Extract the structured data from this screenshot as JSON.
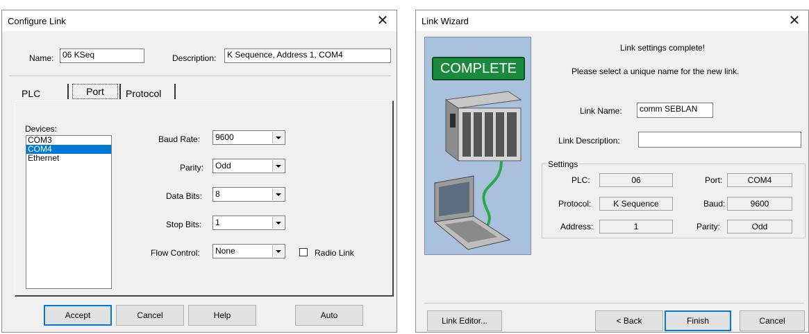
{
  "configure_link": {
    "title": "Configure Link",
    "close_symbol": "✕",
    "name_label": "Name:",
    "name_value": "06 KSeq",
    "description_label": "Description:",
    "description_value": "K Sequence, Address 1, COM4",
    "tabs": [
      {
        "label": "PLC"
      },
      {
        "label": "Port"
      },
      {
        "label": "Protocol"
      }
    ],
    "devices_label": "Devices:",
    "devices": [
      "COM3",
      "COM4",
      "Ethernet"
    ],
    "selected_device": "COM4",
    "baud_rate_label": "Baud Rate:",
    "baud_rate_value": "9600",
    "parity_label": "Parity:",
    "parity_value": "Odd",
    "data_bits_label": "Data Bits:",
    "data_bits_value": "8",
    "stop_bits_label": "Stop Bits:",
    "stop_bits_value": "1",
    "flow_control_label": "Flow Control:",
    "flow_control_value": "None",
    "radio_link_label": "Radio Link",
    "buttons": {
      "accept": "Accept",
      "cancel": "Cancel",
      "help": "Help",
      "auto": "Auto"
    }
  },
  "link_wizard": {
    "title": "Link Wizard",
    "close_symbol": "✕",
    "banner_text": "COMPLETE",
    "message_line1": "Link settings complete!",
    "message_line2": "Please select a unique name for the new link.",
    "link_name_label": "Link Name:",
    "link_name_value": "comm SEBLAN",
    "link_description_label": "Link Description:",
    "link_description_value": "",
    "settings_label": "Settings",
    "plc_label": "PLC:",
    "plc_value": "06",
    "port_label": "Port:",
    "port_value": "COM4",
    "protocol_label": "Protocol:",
    "protocol_value": "K Sequence",
    "baud_label": "Baud:",
    "baud_value": "9600",
    "address_label": "Address:",
    "address_value": "1",
    "parity_label": "Parity:",
    "parity_value": "Odd",
    "buttons": {
      "link_editor": "Link Editor...",
      "back": "< Back",
      "finish": "Finish",
      "cancel": "Cancel"
    }
  },
  "colors": {
    "selection": "#0078d7",
    "banner_green": "#1a8a3c",
    "panel_blue": "#a9c1dc"
  }
}
